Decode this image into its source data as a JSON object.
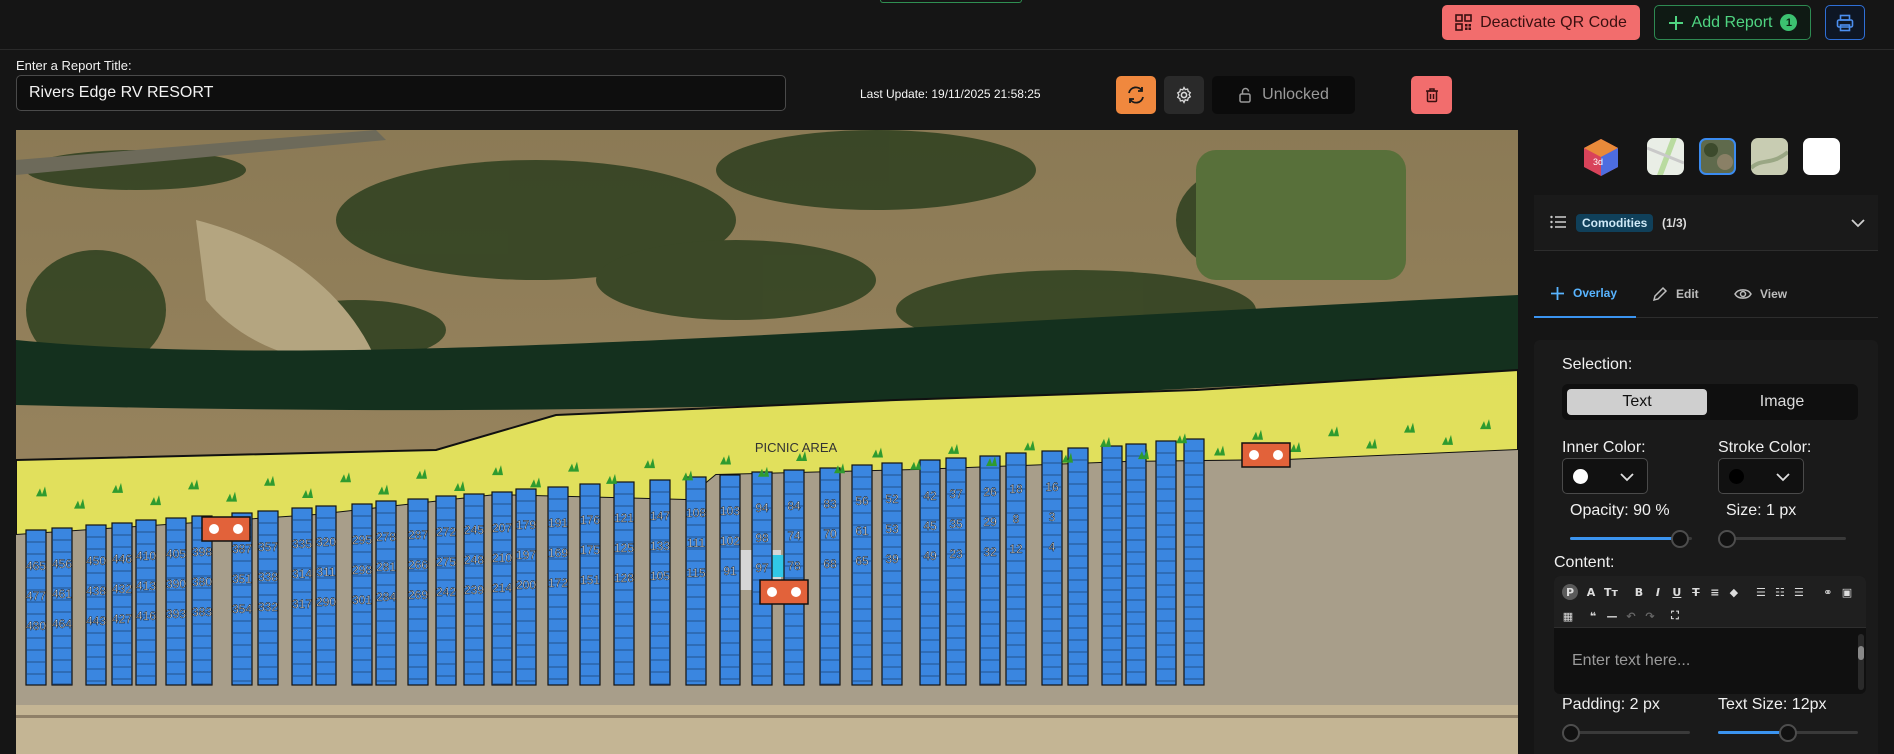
{
  "header": {
    "deactivate_label": "Deactivate QR Code",
    "add_report_label": "Add Report",
    "add_report_badge": "1"
  },
  "report": {
    "title_label": "Enter a Report Title:",
    "title_value": "Rivers Edge RV RESORT",
    "last_update": "Last Update: 19/11/2025 21:58:25",
    "lock_status": "Unlocked"
  },
  "map": {
    "area_label": "PICNIC AREA",
    "site_numbers": [
      "465",
      "477",
      "480",
      "456",
      "461",
      "464",
      "450",
      "438",
      "443",
      "446",
      "432",
      "427",
      "410",
      "413",
      "416",
      "405",
      "390",
      "393",
      "398",
      "380",
      "383",
      "387",
      "351",
      "354",
      "357",
      "338",
      "332",
      "335",
      "314",
      "317",
      "320",
      "311",
      "290",
      "295",
      "298",
      "301",
      "278",
      "281",
      "284",
      "287",
      "266",
      "269",
      "272",
      "275",
      "242",
      "245",
      "248",
      "239",
      "207",
      "210",
      "214",
      "179",
      "197",
      "200",
      "191",
      "169",
      "172",
      "176",
      "175",
      "151",
      "121",
      "125",
      "128",
      "147",
      "133",
      "105",
      "108",
      "111",
      "115",
      "103",
      "102",
      "91",
      "94",
      "98",
      "97",
      "84",
      "74",
      "78",
      "83",
      "70",
      "68",
      "56",
      "61",
      "65",
      "52",
      "53",
      "39",
      "42",
      "45",
      "49",
      "37",
      "35",
      "23",
      "26",
      "29",
      "32",
      "18",
      "8",
      "12",
      "16",
      "3",
      "4"
    ],
    "colors": {
      "site_fill": "#3a86e0",
      "overlay_fill": "#e9ea5c",
      "river": "#14301e",
      "amenity": "#e2623a"
    }
  },
  "right_panel": {
    "layer_icons": [
      "3d-cube-icon",
      "street-map-layer",
      "satellite-layer",
      "terrain-layer",
      "blank-layer"
    ],
    "layer_3d_label": "3d",
    "commodity_chip": "Comodities",
    "commodity_count": "(1/3)",
    "tabs": [
      {
        "label": "Overlay",
        "icon": "plus-icon"
      },
      {
        "label": "Edit",
        "icon": "pencil-icon"
      },
      {
        "label": "View",
        "icon": "eye-icon"
      }
    ],
    "selection_label": "Selection:",
    "selection_options": [
      "Text",
      "Image"
    ],
    "inner_color_label": "Inner Color:",
    "stroke_color_label": "Stroke Color:",
    "opacity_label": "Opacity: 90 %",
    "opacity_value": 0.9,
    "size_label": "Size: 1 px",
    "size_value": 0,
    "content_label": "Content:",
    "content_placeholder": "Enter text here...",
    "padding_label": "Padding: 2 px",
    "padding_value": 0,
    "text_size_label": "Text Size: 12px",
    "text_size_value": 0.5,
    "accent": "#3b94f0"
  }
}
